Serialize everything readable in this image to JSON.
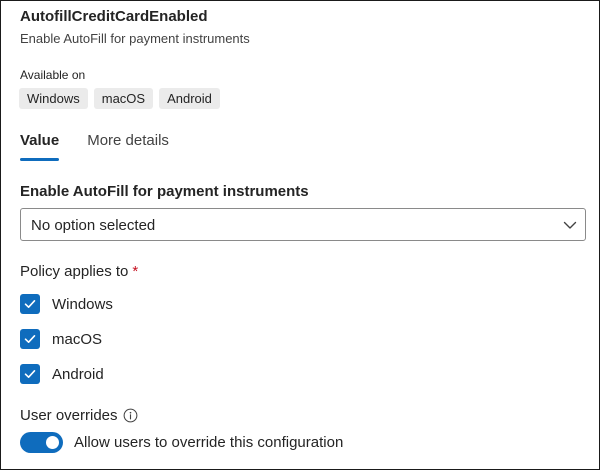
{
  "header": {
    "title": "AutofillCreditCardEnabled",
    "subtitle": "Enable AutoFill for payment instruments"
  },
  "available_on": {
    "label": "Available on",
    "platforms": [
      "Windows",
      "macOS",
      "Android"
    ]
  },
  "tabs": [
    {
      "label": "Value",
      "active": true
    },
    {
      "label": "More details",
      "active": false
    }
  ],
  "setting": {
    "label": "Enable AutoFill for payment instruments",
    "selected_value": "No option selected",
    "chevron_icon": "chevron-down-icon"
  },
  "policy_applies": {
    "label": "Policy applies to",
    "required_marker": "*",
    "options": [
      {
        "label": "Windows",
        "checked": true
      },
      {
        "label": "macOS",
        "checked": true
      },
      {
        "label": "Android",
        "checked": true
      }
    ]
  },
  "user_overrides": {
    "label": "User overrides",
    "info_icon": "info-icon",
    "toggle_label": "Allow users to override this configuration",
    "toggle_on": true
  },
  "colors": {
    "accent": "#0f6cbd",
    "required": "#c50f1f",
    "chip_bg": "#ebebeb"
  }
}
